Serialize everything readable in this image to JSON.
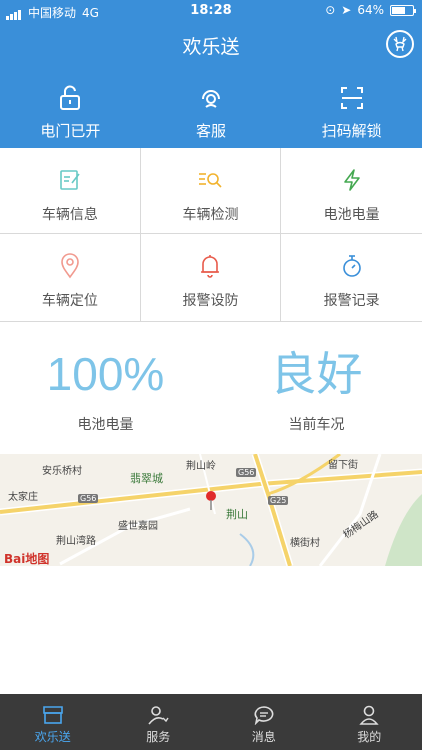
{
  "status_bar": {
    "carrier": "中国移动",
    "network": "4G",
    "time": "18:28",
    "battery_percent": "64%",
    "battery_level": 0.64
  },
  "header": {
    "title": "欢乐送",
    "icon": "deer-logo-icon"
  },
  "top_actions": [
    {
      "label": "电门已开",
      "icon": "unlock-icon"
    },
    {
      "label": "客服",
      "icon": "customer-service-icon"
    },
    {
      "label": "扫码解锁",
      "icon": "scan-icon"
    }
  ],
  "grid": [
    {
      "label": "车辆信息",
      "icon": "edit-doc-icon",
      "color": "#67c9c5"
    },
    {
      "label": "车辆检测",
      "icon": "search-list-icon",
      "color": "#f2b32e"
    },
    {
      "label": "电池电量",
      "icon": "lightning-icon",
      "color": "#44a850"
    },
    {
      "label": "车辆定位",
      "icon": "location-pin-icon",
      "color": "#f19a8f"
    },
    {
      "label": "报警设防",
      "icon": "bell-icon",
      "color": "#e85a4a"
    },
    {
      "label": "报警记录",
      "icon": "stopwatch-icon",
      "color": "#3a8fd9"
    }
  ],
  "stats": [
    {
      "value": "100%",
      "caption": "电池电量"
    },
    {
      "value": "良好",
      "caption": "当前车况"
    }
  ],
  "map": {
    "labels": [
      "荆山岭",
      "留下街",
      "安乐桥村",
      "翡翠城",
      "太家庄",
      "荆山",
      "盛世嘉园",
      "荆山湾路",
      "横街村",
      "杨梅山路",
      "G56",
      "G56",
      "G25",
      "Bai地图"
    ]
  },
  "tabs": [
    {
      "label": "欢乐送",
      "icon": "store-icon",
      "active": true
    },
    {
      "label": "服务",
      "icon": "user-heart-icon",
      "active": false
    },
    {
      "label": "消息",
      "icon": "chat-bubble-icon",
      "active": false
    },
    {
      "label": "我的",
      "icon": "person-icon",
      "active": false
    }
  ],
  "colors": {
    "primary": "#3a8fd9",
    "stat_text": "#7ec4e8",
    "tabbar": "#3a3a3a",
    "tab_active": "#4aa6ee"
  }
}
